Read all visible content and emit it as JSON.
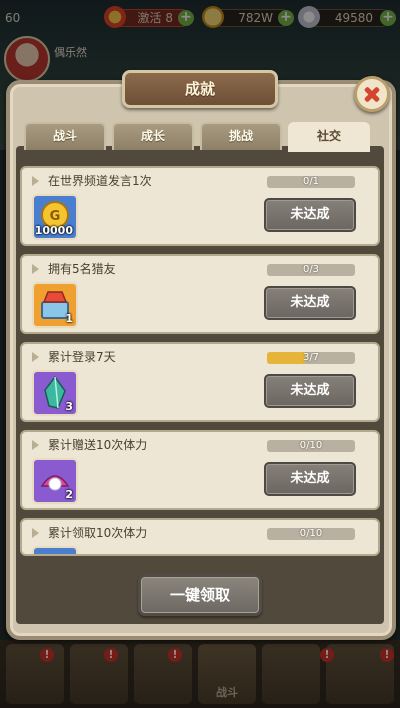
{
  "status_bar": {
    "level": "60",
    "vip_label": "激活 8",
    "gold": "782W",
    "gems": "49580"
  },
  "player": {
    "name": "偶乐然"
  },
  "dialog": {
    "title": "成就"
  },
  "tabs": [
    {
      "label": "战斗",
      "active": false
    },
    {
      "label": "成长",
      "active": false
    },
    {
      "label": "挑战",
      "active": false
    },
    {
      "label": "社交",
      "active": true
    }
  ],
  "tasks": [
    {
      "title": "在世界频道发言1次",
      "progress_text": "0/1",
      "progress": 0,
      "button_label": "未达成",
      "reward_icon": "gold-coin-icon",
      "reward_count": "10000",
      "reward_color": "#4a7fd0"
    },
    {
      "title": "拥有5名猎友",
      "progress_text": "0/3",
      "progress": 0,
      "button_label": "未达成",
      "reward_icon": "treasure-chest-icon",
      "reward_count": "1",
      "reward_color": "#f0a030"
    },
    {
      "title": "累计登录7天",
      "progress_text": "3/7",
      "progress": 0.4286,
      "button_label": "未达成",
      "reward_icon": "crystal-shard-icon",
      "reward_count": "3",
      "reward_color": "#8a5ad0"
    },
    {
      "title": "累计赠送10次体力",
      "progress_text": "0/10",
      "progress": 0,
      "button_label": "未达成",
      "reward_icon": "pearl-shell-icon",
      "reward_count": "2",
      "reward_color": "#8a5ad0"
    },
    {
      "title": "累计领取10次体力",
      "progress_text": "0/10",
      "progress": 0,
      "button_label": "",
      "reward_icon": "reward-item-icon",
      "reward_count": "",
      "reward_color": "#4a7fd0"
    }
  ],
  "footer": {
    "claim_all_label": "一键领取"
  },
  "bottom_nav": {
    "active_label": "战斗"
  }
}
